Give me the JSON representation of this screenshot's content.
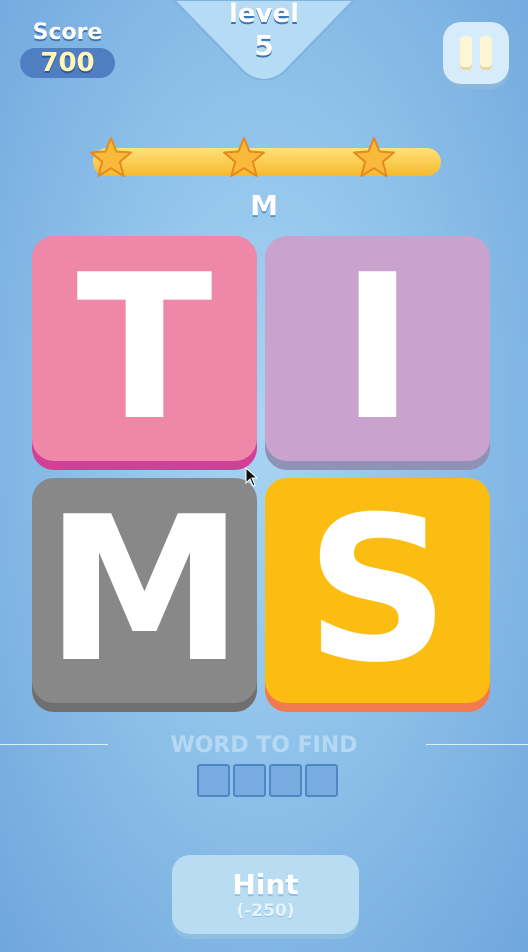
{
  "hud": {
    "score_label": "Score",
    "score_value": "700",
    "level_label": "level",
    "level_number": "5",
    "pause_icon": "pause-icon"
  },
  "progress": {
    "fill_fraction": 1.0,
    "stars": [
      {
        "icon": "star-icon",
        "earned": true
      },
      {
        "icon": "star-icon",
        "earned": true
      },
      {
        "icon": "star-icon",
        "earned": true
      }
    ]
  },
  "current_letter": "M",
  "tiles": [
    {
      "letter": "T",
      "color": "#ef88a8",
      "shadow": "#d23f96"
    },
    {
      "letter": "I",
      "color": "#c9a3cd",
      "shadow": "#8e93b6"
    },
    {
      "letter": "M",
      "color": "#888888",
      "shadow": "#6f6f6f"
    },
    {
      "letter": "S",
      "color": "#fbbd12",
      "shadow": "#f27a4f"
    }
  ],
  "word": {
    "label": "WORD TO FIND",
    "slot_count": 4
  },
  "hint": {
    "label": "Hint",
    "cost": "(-250)"
  },
  "colors": {
    "background": "#8fc2ea",
    "banner": "#b5dbf5",
    "star": "#f9b93a"
  }
}
